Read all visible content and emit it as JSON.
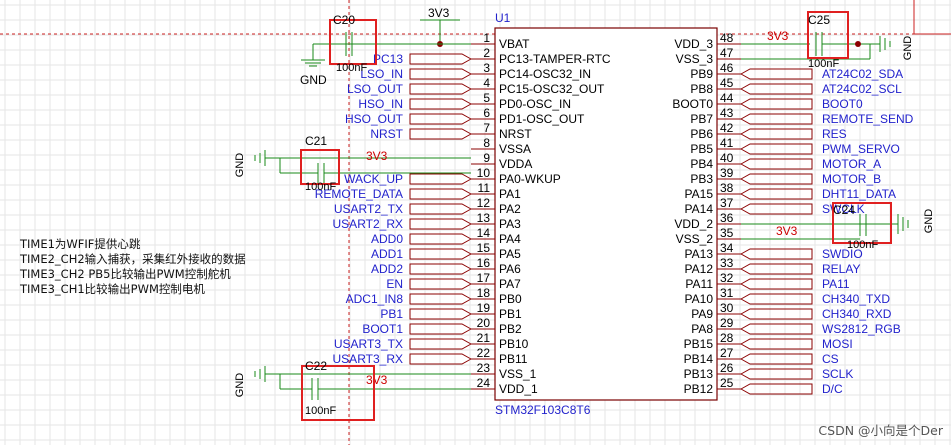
{
  "chip": {
    "ref": "U1",
    "part": "STM32F103C8T6",
    "left_pins": [
      {
        "num": "1",
        "name": "VBAT",
        "net": ""
      },
      {
        "num": "2",
        "name": "PC13-TAMPER-RTC",
        "net": "PC13"
      },
      {
        "num": "3",
        "name": "PC14-OSC32_IN",
        "net": "LSO_IN"
      },
      {
        "num": "4",
        "name": "PC15-OSC32_OUT",
        "net": "LSO_OUT"
      },
      {
        "num": "5",
        "name": "PD0-OSC_IN",
        "net": "HSO_IN"
      },
      {
        "num": "6",
        "name": "PD1-OSC_OUT",
        "net": "HSO_OUT"
      },
      {
        "num": "7",
        "name": "NRST",
        "net": "NRST"
      },
      {
        "num": "8",
        "name": "VSSA",
        "net": ""
      },
      {
        "num": "9",
        "name": "VDDA",
        "net": ""
      },
      {
        "num": "10",
        "name": "PA0-WKUP",
        "net": "WACK_UP"
      },
      {
        "num": "11",
        "name": "PA1",
        "net": "REMOTE_DATA"
      },
      {
        "num": "12",
        "name": "PA2",
        "net": "USART2_TX"
      },
      {
        "num": "13",
        "name": "PA3",
        "net": "USART2_RX"
      },
      {
        "num": "14",
        "name": "PA4",
        "net": "ADD0"
      },
      {
        "num": "15",
        "name": "PA5",
        "net": "ADD1"
      },
      {
        "num": "16",
        "name": "PA6",
        "net": "ADD2"
      },
      {
        "num": "17",
        "name": "PA7",
        "net": "EN"
      },
      {
        "num": "18",
        "name": "PB0",
        "net": "ADC1_IN8"
      },
      {
        "num": "19",
        "name": "PB1",
        "net": "PB1"
      },
      {
        "num": "20",
        "name": "PB2",
        "net": "BOOT1"
      },
      {
        "num": "21",
        "name": "PB10",
        "net": "USART3_TX"
      },
      {
        "num": "22",
        "name": "PB11",
        "net": "USART3_RX"
      },
      {
        "num": "23",
        "name": "VSS_1",
        "net": ""
      },
      {
        "num": "24",
        "name": "VDD_1",
        "net": ""
      }
    ],
    "right_pins": [
      {
        "num": "48",
        "name": "VDD_3",
        "net": ""
      },
      {
        "num": "47",
        "name": "VSS_3",
        "net": ""
      },
      {
        "num": "46",
        "name": "PB9",
        "net": "AT24C02_SDA"
      },
      {
        "num": "45",
        "name": "PB8",
        "net": "AT24C02_SCL"
      },
      {
        "num": "44",
        "name": "BOOT0",
        "net": "BOOT0"
      },
      {
        "num": "43",
        "name": "PB7",
        "net": "REMOTE_SEND"
      },
      {
        "num": "42",
        "name": "PB6",
        "net": "RES"
      },
      {
        "num": "41",
        "name": "PB5",
        "net": "PWM_SERVO"
      },
      {
        "num": "40",
        "name": "PB4",
        "net": "MOTOR_A"
      },
      {
        "num": "39",
        "name": "PB3",
        "net": "MOTOR_B"
      },
      {
        "num": "38",
        "name": "PA15",
        "net": "DHT11_DATA"
      },
      {
        "num": "37",
        "name": "PA14",
        "net": "SWCLK"
      },
      {
        "num": "36",
        "name": "VDD_2",
        "net": ""
      },
      {
        "num": "35",
        "name": "VSS_2",
        "net": ""
      },
      {
        "num": "34",
        "name": "PA13",
        "net": "SWDIO"
      },
      {
        "num": "33",
        "name": "PA12",
        "net": "RELAY"
      },
      {
        "num": "32",
        "name": "PA11",
        "net": "PA11"
      },
      {
        "num": "31",
        "name": "PA10",
        "net": "CH340_TXD"
      },
      {
        "num": "30",
        "name": "PA9",
        "net": "CH340_RXD"
      },
      {
        "num": "29",
        "name": "PA8",
        "net": "WS2812_RGB"
      },
      {
        "num": "28",
        "name": "PB15",
        "net": "MOSI"
      },
      {
        "num": "27",
        "name": "PB14",
        "net": "CS"
      },
      {
        "num": "26",
        "name": "PB13",
        "net": "SCLK"
      },
      {
        "num": "25",
        "name": "PB12",
        "net": "D/C"
      }
    ]
  },
  "power_label": "3V3",
  "gnd_label": "GND",
  "caps": [
    {
      "ref": "C20",
      "value": "100nF"
    },
    {
      "ref": "C25",
      "value": "100nF"
    },
    {
      "ref": "C21",
      "value": "100nF"
    },
    {
      "ref": "C24",
      "value": "100nF"
    },
    {
      "ref": "C22",
      "value": "100nF"
    }
  ],
  "notes": [
    "TIME1为WFIF提供心跳",
    "TIME2_CH2输入捕获，采集红外接收的数据",
    "TIME3_CH2 PB5比较输出PWM控制舵机",
    "TIME3_CH1比较输出PWM控制电机"
  ],
  "watermark": "CSDN @小向是个Der",
  "colors": {
    "wire": "#1a8a1a",
    "net": "#2222cc",
    "power": "#cc0000",
    "box": "#e02020",
    "pin": "#8b0000",
    "body": "#7a0000"
  }
}
